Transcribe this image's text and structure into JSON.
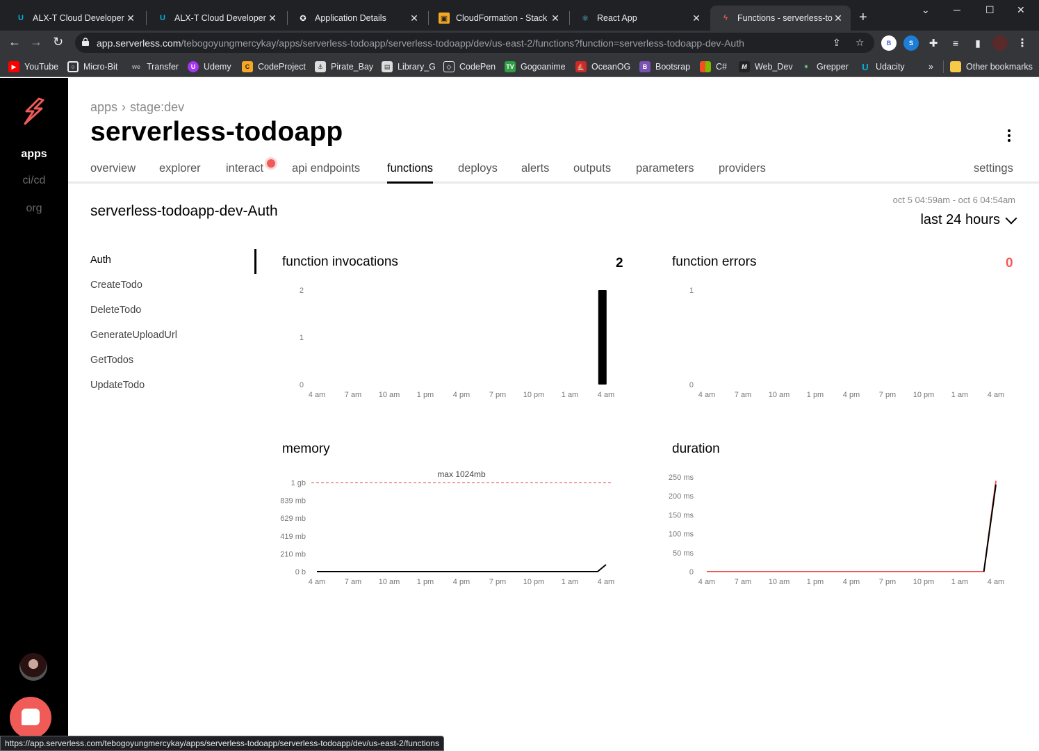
{
  "browser": {
    "tabs": [
      {
        "title": "ALX-T Cloud Developer - U",
        "icon": "udacity-icon"
      },
      {
        "title": "ALX-T Cloud Developer - U",
        "icon": "udacity-icon"
      },
      {
        "title": "Application Details",
        "icon": "auth0-icon"
      },
      {
        "title": "CloudFormation - Stack",
        "icon": "aws-icon"
      },
      {
        "title": "React App",
        "icon": "react-icon"
      },
      {
        "title": "Functions - serverless-todo",
        "icon": "serverless-icon",
        "active": true
      }
    ],
    "url_host": "app.serverless.com",
    "url_path": "/tebogoyungmercykay/apps/serverless-todoapp/serverless-todoapp/dev/us-east-2/functions?function=serverless-todoapp-dev-Auth",
    "profile_initial": "B",
    "bookmarks": [
      {
        "label": "YouTube",
        "icon": "youtube-icon",
        "color": "#ff0000"
      },
      {
        "label": "Micro-Bit",
        "icon": "microbit-icon",
        "color": "#555555"
      },
      {
        "label": "Transfer",
        "icon": "wetransfer-icon",
        "color": "#444444"
      },
      {
        "label": "Udemy",
        "icon": "udemy-icon",
        "color": "#a435f0"
      },
      {
        "label": "CodeProject",
        "icon": "codeproject-icon",
        "color": "#f7a823"
      },
      {
        "label": "Pirate_Bay",
        "icon": "piratebay-icon",
        "color": "#dddddd"
      },
      {
        "label": "Library_G",
        "icon": "library-icon",
        "color": "#dddddd"
      },
      {
        "label": "CodePen",
        "icon": "codepen-icon",
        "color": "#111111"
      },
      {
        "label": "Gogoanime",
        "icon": "gogoanime-icon",
        "color": "#2f9e44"
      },
      {
        "label": "OceanOG",
        "icon": "oceanog-icon",
        "color": "#c92a2a"
      },
      {
        "label": "Bootsrap",
        "icon": "bootstrap-icon",
        "color": "#7952b3"
      },
      {
        "label": "C#",
        "icon": "microsoft-icon",
        "color": "#f25022"
      },
      {
        "label": "Web_Dev",
        "icon": "webdev-icon",
        "color": "#222222"
      },
      {
        "label": "Grepper",
        "icon": "grepper-icon",
        "color": "#555555"
      },
      {
        "label": "Udacity",
        "icon": "udacity-icon",
        "color": "#02b3e4"
      }
    ],
    "more_bookmarks": "»",
    "other_bookmarks": "Other bookmarks",
    "status_url": "https://app.serverless.com/tebogoyungmercykay/apps/serverless-todoapp/serverless-todoapp/dev/us-east-2/functions"
  },
  "sidebar": {
    "items": [
      {
        "label": "apps",
        "active": true
      },
      {
        "label": "ci/cd"
      },
      {
        "label": "org"
      }
    ]
  },
  "header": {
    "breadcrumb": [
      "apps",
      "stage:dev"
    ],
    "title": "serverless-todoapp"
  },
  "nav_tabs": [
    {
      "label": "overview"
    },
    {
      "label": "explorer"
    },
    {
      "label": "interact"
    },
    {
      "label": "api endpoints"
    },
    {
      "label": "functions",
      "active": true
    },
    {
      "label": "deploys"
    },
    {
      "label": "alerts"
    },
    {
      "label": "outputs"
    },
    {
      "label": "parameters"
    },
    {
      "label": "providers"
    },
    {
      "label": "settings"
    }
  ],
  "function": {
    "name": "serverless-todoapp-dev-Auth",
    "date_range": "oct 5 04:59am - oct 6 04:54am",
    "range_label": "last 24 hours",
    "list": [
      "Auth",
      "CreateTodo",
      "DeleteTodo",
      "GenerateUploadUrl",
      "GetTodos",
      "UpdateTodo"
    ]
  },
  "chart_data": [
    {
      "type": "bar",
      "title": "function invocations",
      "total": "2",
      "x_ticks": [
        "4 am",
        "7 am",
        "10 am",
        "1 pm",
        "4 pm",
        "7 pm",
        "10 pm",
        "1 am",
        "4 am"
      ],
      "y_ticks": [
        "0",
        "1",
        "2"
      ],
      "ylim": [
        0,
        2
      ],
      "series": [
        {
          "values": [
            {
              "x_hour": 23.7,
              "y": 2
            }
          ]
        }
      ],
      "color": "#000000"
    },
    {
      "type": "line",
      "title": "function errors",
      "total": "0",
      "x_ticks": [
        "4 am",
        "7 am",
        "10 am",
        "1 pm",
        "4 pm",
        "7 pm",
        "10 pm",
        "1 am",
        "4 am"
      ],
      "y_ticks": [
        "0",
        "1"
      ],
      "ylim": [
        0,
        1
      ],
      "series": [],
      "color": "#f05a57"
    },
    {
      "type": "line",
      "title": "memory",
      "x_ticks": [
        "4 am",
        "7 am",
        "10 am",
        "1 pm",
        "4 pm",
        "7 pm",
        "10 pm",
        "1 am",
        "4 am"
      ],
      "y_ticks": [
        "0 b",
        "210 mb",
        "419 mb",
        "629 mb",
        "839 mb",
        "1 gb"
      ],
      "ylim": [
        0,
        1024
      ],
      "max_line": {
        "label": "max 1024mb",
        "value": 1024
      },
      "series": [
        {
          "points": [
            [
              0,
              0
            ],
            [
              23.3,
              0
            ],
            [
              24,
              80
            ]
          ]
        }
      ],
      "color": "#000000"
    },
    {
      "type": "line",
      "title": "duration",
      "x_ticks": [
        "4 am",
        "7 am",
        "10 am",
        "1 pm",
        "4 pm",
        "7 pm",
        "10 pm",
        "1 am",
        "4 am"
      ],
      "y_ticks": [
        "0",
        "50 ms",
        "100 ms",
        "150 ms",
        "200 ms",
        "250 ms"
      ],
      "ylim": [
        0,
        250
      ],
      "series": [
        {
          "points": [
            [
              0,
              0
            ],
            [
              23.0,
              0
            ],
            [
              24,
              240
            ]
          ],
          "color": "#f05a57"
        },
        {
          "points": [
            [
              23.0,
              0
            ],
            [
              24,
              230
            ]
          ],
          "color": "#000000"
        }
      ]
    }
  ],
  "colors": {
    "accent": "#f05a57",
    "sidebar": "#000000",
    "chrome": "#35363a"
  }
}
